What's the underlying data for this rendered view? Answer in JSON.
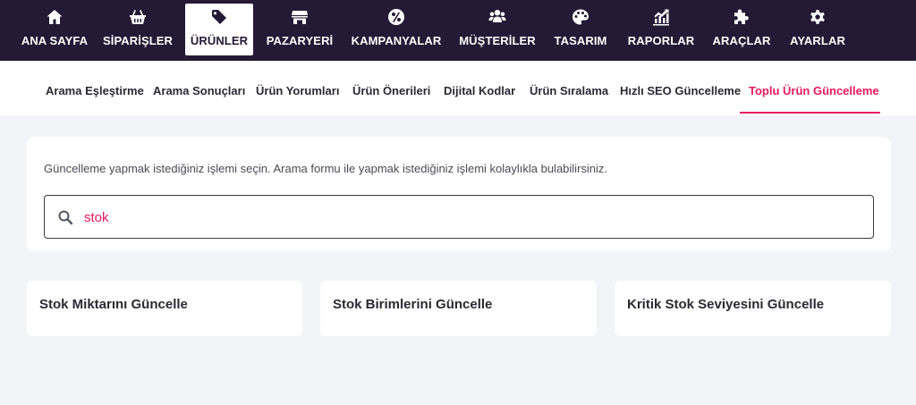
{
  "topnav": {
    "items": [
      {
        "label": "ANA SAYFA",
        "icon": "home-icon"
      },
      {
        "label": "SİPARİŞLER",
        "icon": "basket-icon"
      },
      {
        "label": "ÜRÜNLER",
        "icon": "tag-icon",
        "active": true
      },
      {
        "label": "PAZARYERİ",
        "icon": "store-icon"
      },
      {
        "label": "KAMPANYALAR",
        "icon": "percent-icon"
      },
      {
        "label": "MÜŞTERİLER",
        "icon": "users-icon"
      },
      {
        "label": "TASARIM",
        "icon": "palette-icon"
      },
      {
        "label": "RAPORLAR",
        "icon": "chart-icon"
      },
      {
        "label": "ARAÇLAR",
        "icon": "puzzle-icon"
      },
      {
        "label": "AYARLAR",
        "icon": "gear-icon"
      }
    ]
  },
  "subnav": {
    "items": [
      {
        "label": "Arama Eşleştirme"
      },
      {
        "label": "Arama Sonuçları"
      },
      {
        "label": "Ürün Yorumları"
      },
      {
        "label": "Ürün Önerileri"
      },
      {
        "label": "Dijital Kodlar"
      },
      {
        "label": "Ürün Sıralama"
      },
      {
        "label": "Hızlı SEO Güncelleme"
      },
      {
        "label": "Toplu Ürün Güncelleme",
        "active": true
      }
    ]
  },
  "search": {
    "description": "Güncelleme yapmak istediğiniz işlemi seçin. Arama formu ile yapmak istediğiniz işlemi kolaylıkla bulabilirsiniz.",
    "value": "stok"
  },
  "results": [
    {
      "label": "Stok Miktarını Güncelle"
    },
    {
      "label": "Stok Birimlerini Güncelle"
    },
    {
      "label": "Kritik Stok Seviyesini Güncelle"
    }
  ],
  "colors": {
    "nav_bg": "#241a35",
    "accent": "#e5195f",
    "page_bg": "#f3f4f8"
  }
}
